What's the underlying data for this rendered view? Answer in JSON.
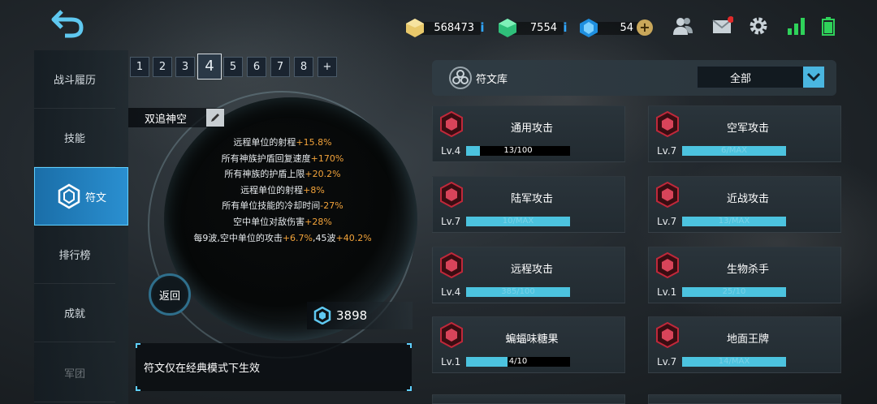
{
  "resources": {
    "gold": "568473",
    "gems": "7554",
    "crystals": "54"
  },
  "nav": [
    {
      "label": "战斗履历"
    },
    {
      "label": "技能"
    },
    {
      "label": "符文"
    },
    {
      "label": "排行榜"
    },
    {
      "label": "成就"
    },
    {
      "label": "军团"
    }
  ],
  "pages": [
    "1",
    "2",
    "3",
    "4",
    "5",
    "6",
    "7",
    "8",
    "+"
  ],
  "active_page": "4",
  "preset": {
    "name": "双追神空"
  },
  "stats": [
    {
      "text": "远程单位的射程",
      "value": "+15.8%"
    },
    {
      "text": "所有神族护盾回复速度",
      "value": "+170%"
    },
    {
      "text": "所有神族的护盾上限",
      "value": "+20.2%"
    },
    {
      "text": "远程单位的射程",
      "value": "+8%"
    },
    {
      "text": "所有单位技能的冷却时间",
      "value": "-27%"
    },
    {
      "text": "空中单位对敌伤害",
      "value": "+28%"
    },
    {
      "text": "每9波,空中单位的攻击",
      "value": "+6.7%",
      "text2": ",45波",
      "value2": "+40.2%"
    }
  ],
  "back_label": "返回",
  "points": "3898",
  "notice": "符文仅在经典模式下生效",
  "library": {
    "title": "符文库",
    "filter": "全部"
  },
  "cards": [
    {
      "name": "通用攻击",
      "level": "Lv.4",
      "progress": "13/100",
      "fill": 0.13
    },
    {
      "name": "空军攻击",
      "level": "Lv.7",
      "progress": "6/MAX",
      "fill": 1.0
    },
    {
      "name": "陆军攻击",
      "level": "Lv.7",
      "progress": "10/MAX",
      "fill": 1.0
    },
    {
      "name": "近战攻击",
      "level": "Lv.7",
      "progress": "13/MAX",
      "fill": 1.0
    },
    {
      "name": "远程攻击",
      "level": "Lv.4",
      "progress": "385/100",
      "fill": 1.0
    },
    {
      "name": "生物杀手",
      "level": "Lv.1",
      "progress": "25/10",
      "fill": 1.0
    },
    {
      "name": "蝙蝠味糖果",
      "level": "Lv.1",
      "progress": "4/10",
      "fill": 0.4
    },
    {
      "name": "地面王牌",
      "level": "Lv.7",
      "progress": "14/MAX",
      "fill": 1.0
    }
  ],
  "colors": {
    "accent": "#4cc3df",
    "highlight": "#f2a33a",
    "active_nav": "#1a6ea8"
  }
}
